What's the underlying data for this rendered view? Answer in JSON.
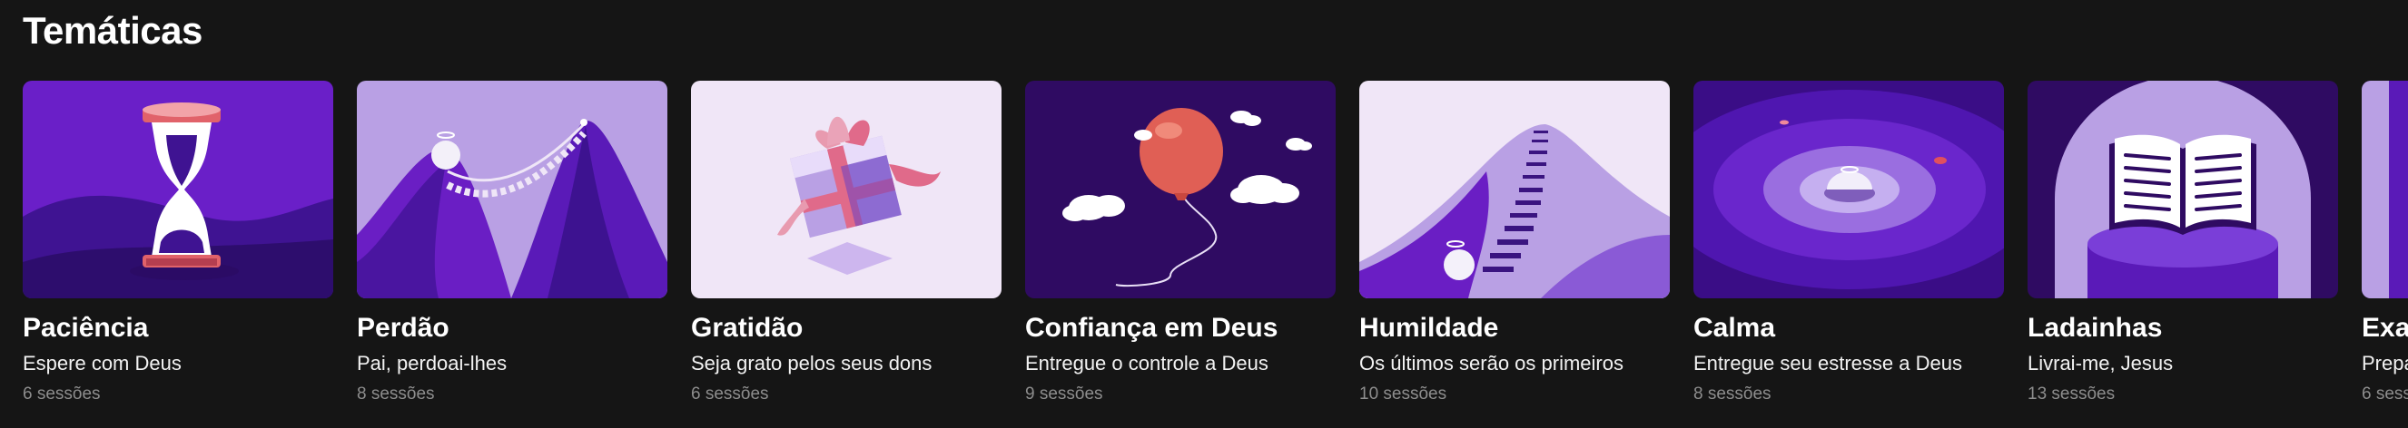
{
  "section": {
    "title": "Temáticas"
  },
  "cards": [
    {
      "title": "Paciência",
      "subtitle": "Espere com Deus",
      "sessions": "6 sessões"
    },
    {
      "title": "Perdão",
      "subtitle": "Pai, perdoai-lhes",
      "sessions": "8 sessões"
    },
    {
      "title": "Gratidão",
      "subtitle": "Seja grato pelos seus dons",
      "sessions": "6 sessões"
    },
    {
      "title": "Confiança em Deus",
      "subtitle": "Entregue o controle a Deus",
      "sessions": "9 sessões"
    },
    {
      "title": "Humildade",
      "subtitle": "Os últimos serão os primeiros",
      "sessions": "10 sessões"
    },
    {
      "title": "Calma",
      "subtitle": "Entregue seu estresse a Deus",
      "sessions": "8 sessões"
    },
    {
      "title": "Ladainhas",
      "subtitle": "Livrai-me, Jesus",
      "sessions": "13 sessões"
    },
    {
      "title": "Exa",
      "subtitle": "Prepa",
      "sessions": "6 sess"
    }
  ],
  "colors": {
    "background": "#151515",
    "purple_dark": "#2e0c5f",
    "purple": "#6a1ec4",
    "lavender": "#b9a0e4",
    "lavender_light": "#efe6f7",
    "coral": "#e06a5c"
  },
  "icons": [
    "hourglass-icon",
    "rope-bridge-icon",
    "gift-box-icon",
    "balloon-icon",
    "staircase-icon",
    "calm-ripple-icon",
    "open-bible-icon"
  ]
}
